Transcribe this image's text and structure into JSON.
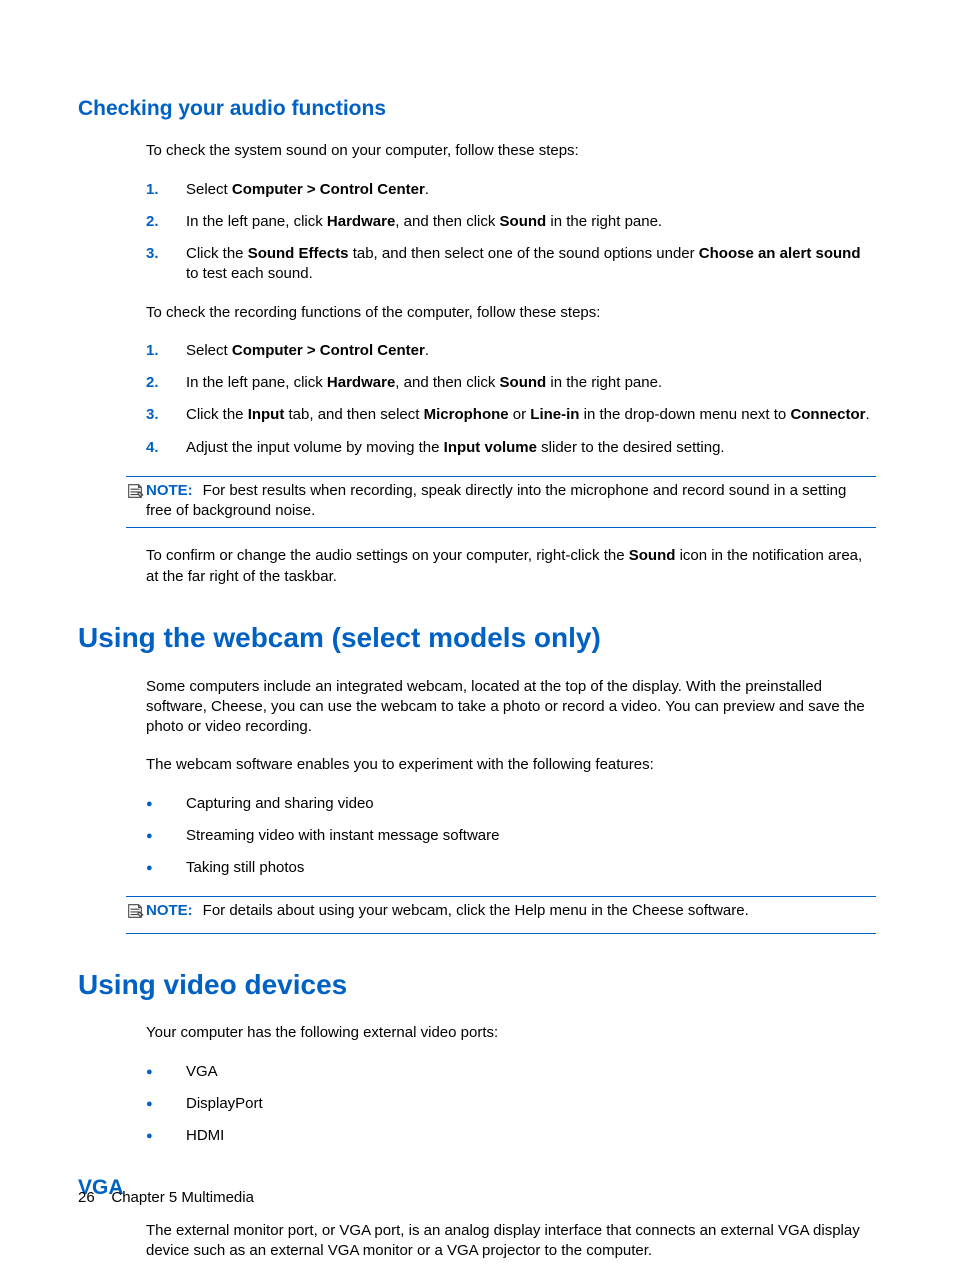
{
  "sections": {
    "audio": {
      "heading": "Checking your audio functions",
      "intro1": "To check the system sound on your computer, follow these steps:",
      "steps1": [
        {
          "pre": "Select ",
          "bold": "Computer > Control Center",
          "post": "."
        },
        {
          "pre": "In the left pane, click ",
          "bold1": "Hardware",
          "mid": ", and then click ",
          "bold2": "Sound",
          "post": " in the right pane."
        },
        {
          "pre": "Click the ",
          "bold1": "Sound Effects",
          "mid": " tab, and then select one of the sound options under ",
          "bold2": "Choose an alert sound",
          "post": " to test each sound."
        }
      ],
      "intro2": "To check the recording functions of the computer, follow these steps:",
      "steps2": [
        {
          "pre": "Select ",
          "bold": "Computer > Control Center",
          "post": "."
        },
        {
          "pre": "In the left pane, click ",
          "bold1": "Hardware",
          "mid": ", and then click ",
          "bold2": "Sound",
          "post": " in the right pane."
        },
        {
          "pre": "Click the ",
          "bold1": "Input",
          "mid": " tab, and then select ",
          "bold2": "Microphone",
          "mid2": " or ",
          "bold3": "Line-in",
          "mid3": " in the drop-down menu next to ",
          "bold4": "Connector",
          "post": "."
        },
        {
          "pre": "Adjust the input volume by moving the ",
          "bold": "Input volume",
          "post": " slider to the desired setting."
        }
      ],
      "note1_label": "NOTE:",
      "note1_text": "For best results when recording, speak directly into the microphone and record sound in a setting free of background noise.",
      "confirm_pre": "To confirm or change the audio settings on your computer, right-click the ",
      "confirm_bold": "Sound",
      "confirm_post": " icon in the notification area, at the far right of the taskbar."
    },
    "webcam": {
      "heading": "Using the webcam (select models only)",
      "p1": "Some computers include an integrated webcam, located at the top of the display. With the preinstalled software, Cheese, you can use the webcam to take a photo or record a video. You can preview and save the photo or video recording.",
      "p2": "The webcam software enables you to experiment with the following features:",
      "bullets": [
        "Capturing and sharing video",
        "Streaming video with instant message software",
        "Taking still photos"
      ],
      "note_label": "NOTE:",
      "note_text": "For details about using your webcam, click the Help menu in the Cheese software."
    },
    "video": {
      "heading": "Using video devices",
      "p1": "Your computer has the following external video ports:",
      "bullets": [
        "VGA",
        "DisplayPort",
        "HDMI"
      ]
    },
    "vga": {
      "heading": "VGA",
      "p1": "The external monitor port, or VGA port, is an analog display interface that connects an external VGA display device such as an external VGA monitor or a VGA projector to the computer."
    }
  },
  "footer": {
    "page": "26",
    "chapter": "Chapter 5   Multimedia"
  }
}
